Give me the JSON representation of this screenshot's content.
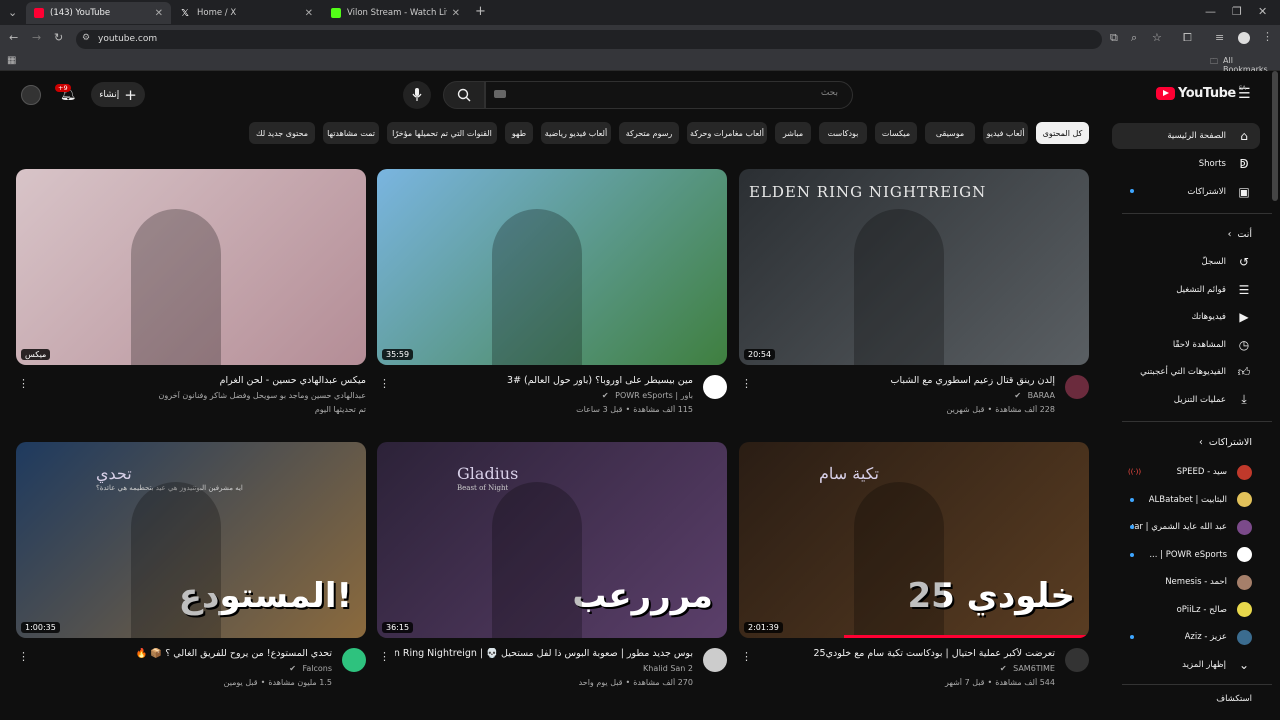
{
  "browser": {
    "tabs": [
      {
        "title": "(143) YouTube",
        "active": true,
        "color": "#ff0033"
      },
      {
        "title": "Home / X",
        "active": false,
        "color": "#ffffff"
      },
      {
        "title": "Vilon Stream - Watch Live on K",
        "active": false,
        "color": "#53fc18"
      }
    ],
    "new_tab": "+",
    "url": "youtube.com",
    "bookmarks_label": "All Bookmarks"
  },
  "header": {
    "logo_text": "YouTube",
    "region": "SA",
    "search_placeholder": "بحث",
    "create_label": "إنشاء",
    "notifications_count": "+9"
  },
  "chips": [
    {
      "label": "كل المحتوى",
      "selected": true
    },
    {
      "label": "ألعاب فيديو"
    },
    {
      "label": "موسيقى"
    },
    {
      "label": "ميكسات"
    },
    {
      "label": "بودكاست"
    },
    {
      "label": "مباشر"
    },
    {
      "label": "ألعاب مغامرات وحركة"
    },
    {
      "label": "رسوم متحركة"
    },
    {
      "label": "ألعاب فيديو رياضية"
    },
    {
      "label": "طهو"
    },
    {
      "label": "القنوات التي تم تحميلها مؤخرًا"
    },
    {
      "label": "تمت مشاهدتها"
    },
    {
      "label": "محتوى جديد لك"
    }
  ],
  "sidebar": {
    "main": [
      {
        "label": "الصفحة الرئيسية",
        "icon": "home-icon",
        "selected": true
      },
      {
        "label": "Shorts",
        "icon": "shorts-icon"
      },
      {
        "label": "الاشتراكات",
        "icon": "subscriptions-icon"
      }
    ],
    "you_heading": "أنت",
    "you": [
      {
        "label": "السجلّ",
        "icon": "history-icon"
      },
      {
        "label": "قوائم التشغيل",
        "icon": "playlists-icon"
      },
      {
        "label": "فيديوهاتك",
        "icon": "your-videos-icon"
      },
      {
        "label": "المشاهدة لاحقًا",
        "icon": "watch-later-icon"
      },
      {
        "label": "الفيديوهات التي أعجبتني",
        "icon": "liked-icon"
      },
      {
        "label": "عمليات التنزيل",
        "icon": "download-icon"
      }
    ],
    "subs_heading": "الاشتراكات",
    "subs": [
      {
        "label": "سيد - SPEED",
        "color": "#c0392b",
        "live": true
      },
      {
        "label": "البثابيت | ALBatabet",
        "color": "#e1c15a",
        "dot": true
      },
      {
        "label": "عبد الله عايد الشمري | xBear",
        "color": "#7b4a8a",
        "dot": true
      },
      {
        "label": "POWR eSports | ...",
        "color": "#ffffff",
        "dot": true
      },
      {
        "label": "أحمد - Nemesis",
        "color": "#a57f6a"
      },
      {
        "label": "صالح - oPiiLz",
        "color": "#e8d84c"
      },
      {
        "label": "عزيز - Aziz",
        "color": "#3b6c8f",
        "dot": true
      }
    ],
    "show_more": "إظهار المزيد",
    "explore_heading": "استكشاف"
  },
  "videos": [
    {
      "title": "إلدن رينق قتال زعيم اسطوري مع الشباب",
      "channel": "BARAA",
      "verified": true,
      "views": "228 ألف مشاهدة",
      "age": "قبل شهرين",
      "duration": "20:54",
      "avatar_color": "#6b2b3d",
      "thumb_text": "ELDEN RING NIGHTREIGN",
      "thumb_colors": [
        "#2b2f33",
        "#5a5f63"
      ]
    },
    {
      "title": "مين بيسيطر على اوروبا؟ (باور حول العالم) #3",
      "channel": "باور | POWR eSports",
      "verified": true,
      "views": "115 ألف مشاهدة",
      "age": "قبل 3 ساعات",
      "duration": "35:59",
      "avatar_color": "#ffffff",
      "thumb_colors": [
        "#7ab5e0",
        "#3f7f3f"
      ]
    },
    {
      "title": "ميكس عبدالهادي حسين - لحن الغرام",
      "channel": "عبدالهادي حسين وماجد بو سويحل وفضل شاكر وفنانون آخرون",
      "verified": false,
      "views": "تم تحديثها اليوم",
      "age": "",
      "duration": "ميكس",
      "avatar_color": "",
      "thumb_colors": [
        "#d8c4c8",
        "#b48d96"
      ]
    },
    {
      "title": "تعرضت لأكبر عملية احتيال | بودكاست تكية سام مع خلودي25",
      "channel": "SAM6TIME",
      "verified": true,
      "views": "544 ألف مشاهدة",
      "age": "قبل 7 أشهر",
      "duration": "2:01:39",
      "avatar_color": "#333333",
      "thumb_text": "خلودي 25",
      "thumb_text2": "تكية سام",
      "thumb_colors": [
        "#2a1d14",
        "#5a3d22"
      ]
    },
    {
      "title": "بوس جديد مطور | صعوبة البوس ذا لفل مستحيل 💀 | Elden Ring Nightreign",
      "channel": "Khalid San 2",
      "verified": false,
      "views": "270 ألف مشاهدة",
      "age": "قبل يوم واحد",
      "duration": "36:15",
      "avatar_color": "#cccccc",
      "thumb_text": "مرررعب",
      "thumb_text2": "Gladius",
      "thumb_text3": "Beast of Night",
      "thumb_colors": [
        "#2c2238",
        "#5b3f6a"
      ]
    },
    {
      "title": "تحدي المستودع! من يروح للفريق الغالي ؟ 📦 🔥",
      "channel": "Falcons",
      "verified": true,
      "views": "1.5 مليون مشاهدة",
      "age": "قبل يومين",
      "duration": "1:00:35",
      "avatar_color": "#2ec27e",
      "thumb_text": "المستودع!",
      "thumb_text2": "تحدي",
      "thumb_text3": "ايه مشرفين البوتنيدوز هي عيد بتحطيمه هي عائدة؟",
      "thumb_colors": [
        "#1e3a5f",
        "#8b6a3d"
      ]
    }
  ]
}
